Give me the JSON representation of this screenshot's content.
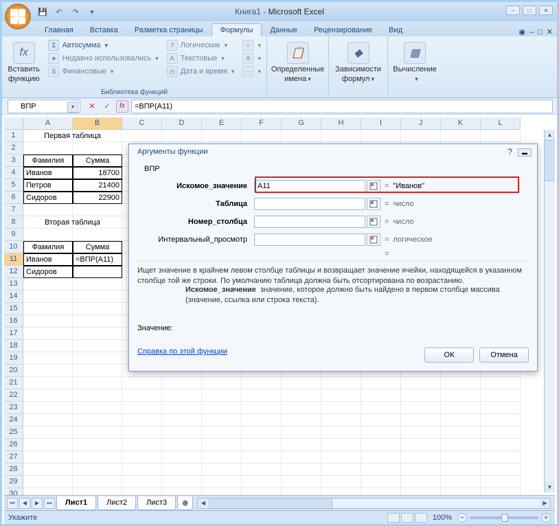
{
  "title_doc": "Книга1",
  "title_app": "Microsoft Excel",
  "qat": {
    "save": "💾",
    "undo": "↶",
    "redo": "↷"
  },
  "tabs": {
    "home": "Главная",
    "insert": "Вставка",
    "layout": "Разметка страницы",
    "formulas": "Формулы",
    "data": "Данные",
    "review": "Рецензирование",
    "view": "Вид"
  },
  "ribbon": {
    "insert_fn_1": "Вставить",
    "insert_fn_2": "функцию",
    "autosum": "Автосумма",
    "recent": "Недавно использовались",
    "financial": "Финансовые",
    "logical": "Логические",
    "text": "Текстовые",
    "datetime": "Дата и время",
    "lib_label": "Библиотека функций",
    "names_1": "Определенные",
    "names_2": "имена",
    "deps_1": "Зависимости",
    "deps_2": "формул",
    "calc": "Вычисление"
  },
  "namebox": "ВПР",
  "formula": "=ВПР(A11)",
  "cols": [
    "A",
    "B",
    "C",
    "D",
    "E",
    "F",
    "G",
    "H",
    "I",
    "J",
    "K",
    "L"
  ],
  "rows": [
    "1",
    "2",
    "3",
    "4",
    "5",
    "6",
    "7",
    "8",
    "9",
    "10",
    "11",
    "12",
    "13",
    "14",
    "15",
    "16",
    "17",
    "18",
    "19",
    "20",
    "21",
    "22",
    "23",
    "24",
    "25",
    "26",
    "27",
    "28",
    "29",
    "30"
  ],
  "cells": {
    "a1": "Первая таблица",
    "a3": "Фамилия",
    "b3": "Сумма",
    "a4": "Иванов",
    "b4": "18700",
    "a5": "Петров",
    "b5": "21400",
    "a6": "Сидоров",
    "b6": "22900",
    "a8": "Вторая таблица",
    "a10": "Фамилия",
    "b10": "Сумма",
    "a11": "Иванов",
    "b11": "=ВПР(A11)",
    "a12": "Сидоров"
  },
  "dialog": {
    "title": "Аргументы функции",
    "func": "ВПР",
    "args": {
      "lookup": "Искомое_значение",
      "table": "Таблица",
      "col": "Номер_столбца",
      "range": "Интервальный_просмотр"
    },
    "vals": {
      "lookup": "A11"
    },
    "results": {
      "lookup": "\"Иванов\"",
      "table": "число",
      "col": "число",
      "range": "логическое"
    },
    "desc": "Ищет значение в крайнем левом столбце таблицы и возвращает значение ячейки, находящейся в указанном столбце той же строки. По умолчанию таблица должна быть отсортирована по возрастанию.",
    "argname": "Искомое_значение",
    "argdesc": "значение, которое должно быть найдено в первом столбце массива (значение, ссылка или строка текста).",
    "value_label": "Значение:",
    "link": "Справка по этой функции",
    "ok": "ОК",
    "cancel": "Отмена"
  },
  "sheets": {
    "s1": "Лист1",
    "s2": "Лист2",
    "s3": "Лист3"
  },
  "status": {
    "mode": "Укажите",
    "zoom": "100%"
  }
}
